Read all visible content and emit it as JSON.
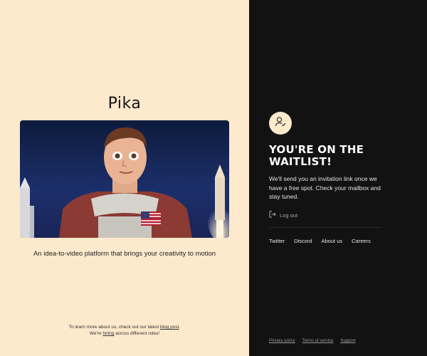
{
  "brand": {
    "logo_text": "Pika"
  },
  "hero": {
    "image_alt": "cartoon astronaut with rockets"
  },
  "tagline": "An idea-to-video platform that brings your creativity to motion",
  "footnote": {
    "line1_prefix": "To learn more about us, check out our latest ",
    "line1_link": "blog post",
    "line1_suffix": ".",
    "line2_prefix": "We're ",
    "line2_link": "hiring",
    "line2_suffix": " across different roles!"
  },
  "panel": {
    "icon": "user-check-icon",
    "heading": "YOU'RE ON THE WAITLIST!",
    "body": "We'll send you an invitation link once we have a free spot. Check your mailbox and stay tuned.",
    "logout_label": "Log out",
    "links": [
      "Twitter",
      "Discord",
      "About us",
      "Careers"
    ],
    "legal": [
      "Privacy policy",
      "Terms of service",
      "Support"
    ]
  },
  "colors": {
    "left_bg": "#fde9cc",
    "right_bg": "#121212"
  }
}
